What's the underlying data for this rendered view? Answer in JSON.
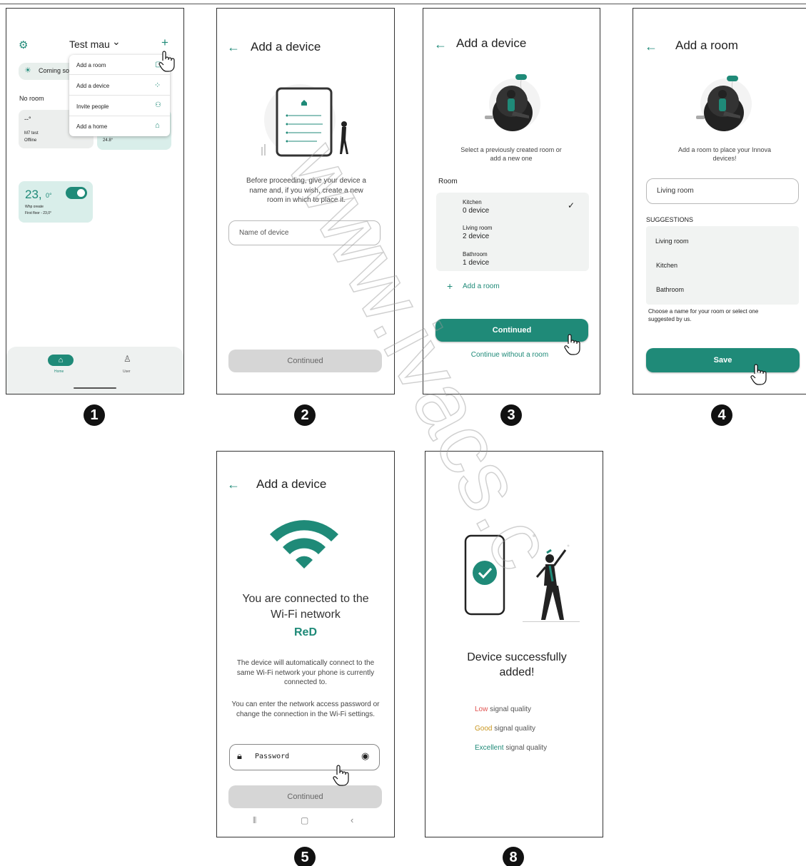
{
  "screen1": {
    "title": "Test mau",
    "title_chevron": "⌄",
    "plus": "+",
    "coming_soon": "Coming so",
    "no_room": "No room",
    "device1_value": "--°",
    "device1_name": "M7 test",
    "device1_status": "Offline",
    "device2_value": "24.8°",
    "temp_value": "23,",
    "temp_decimal": "0°",
    "temp_label1": "Whp oreate",
    "temp_label2": "First floor - 23,0°",
    "menu": [
      "Add a room",
      "Add a device",
      "Invite people",
      "Add a home"
    ],
    "nav_home": "Home",
    "nav_user": "User"
  },
  "screen2": {
    "title": "Add a device",
    "description": "Before proceeding, give your device a name and, if you wish, create a new room in which to place it.",
    "input_placeholder": "Name of device",
    "continue": "Continued"
  },
  "screen3": {
    "title": "Add a device",
    "description": "Select a previously created room or add a new one",
    "room_label": "Room",
    "rooms": [
      {
        "name": "Kitchen",
        "count": "0 device"
      },
      {
        "name": "Living room",
        "count": "2 device"
      },
      {
        "name": "Bathroom",
        "count": "1 device"
      }
    ],
    "add_room": "Add a room",
    "continue": "Continued",
    "continue_without": "Continue without a room"
  },
  "screen4": {
    "title": "Add a room",
    "description": "Add a room to place your Innova devices!",
    "input_value": "Living room",
    "suggestions_label": "SUGGESTIONS",
    "suggestions": [
      "Living room",
      "Kitchen",
      "Bathroom"
    ],
    "hint": "Choose a name for your room or select one suggested by us.",
    "save": "Save"
  },
  "screen5": {
    "title": "Add a device",
    "connected_line1": "You are connected to the",
    "connected_line2": "Wi-Fi network",
    "network_name": "ReD",
    "para1": "The device will automatically connect to the same Wi-Fi network your phone is currently connected to.",
    "para2": "You can enter the network access password or change the connection in the Wi-Fi settings.",
    "password_placeholder": "Password",
    "continue": "Continued"
  },
  "screen8": {
    "success_line1": "Device successfully",
    "success_line2": "added!",
    "q_low_word": "Low",
    "q_low_rest": " signal quality",
    "q_good_word": "Good",
    "q_good_rest": " signal quality",
    "q_exc_word": "Excellent",
    "q_exc_rest": " signal quality"
  },
  "steps": [
    "1",
    "2",
    "3",
    "4",
    "5",
    "8"
  ],
  "watermark": "www.ivacs.c",
  "colors": {
    "accent": "#1f8a78",
    "low": "#e0524f",
    "good": "#c9961f",
    "excellent": "#1f8a78"
  }
}
